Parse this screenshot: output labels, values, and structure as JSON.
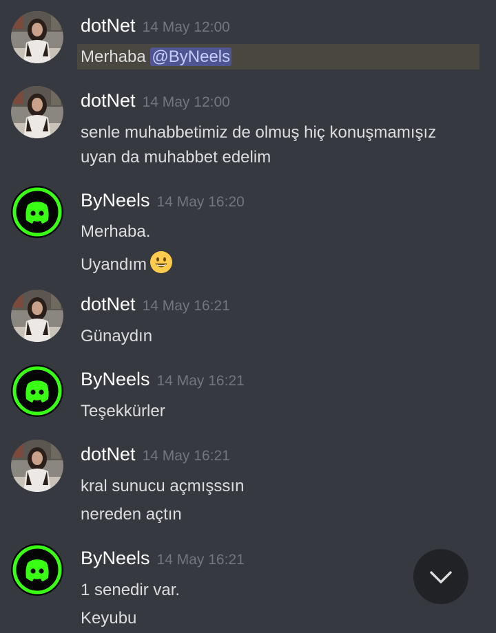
{
  "messages": [
    {
      "author": "dotNet",
      "avatar": "woman-photo-avatar",
      "timestamp": "14 May 12:00",
      "mention_prefix": "Merhaba ",
      "mention": "@ByNeels"
    },
    {
      "author": "dotNet",
      "avatar": "woman-photo-avatar",
      "timestamp": "14 May 12:00",
      "lines": [
        "senle muhabbetimiz de olmuş hiç konuşmamışız",
        "uyan da muhabbet edelim"
      ]
    },
    {
      "author": "ByNeels",
      "avatar": "discord-logo-avatar",
      "timestamp": "14 May 16:20",
      "lines": [
        "Merhaba.",
        "Uyandım"
      ],
      "emoji": "grinning-face-emoji"
    },
    {
      "author": "dotNet",
      "avatar": "woman-photo-avatar",
      "timestamp": "14 May 16:21",
      "lines": [
        "Günaydın"
      ]
    },
    {
      "author": "ByNeels",
      "avatar": "discord-logo-avatar",
      "timestamp": "14 May 16:21",
      "lines": [
        "Teşekkürler"
      ]
    },
    {
      "author": "dotNet",
      "avatar": "woman-photo-avatar",
      "timestamp": "14 May 16:21",
      "lines": [
        "kral sunucu açmışssın",
        "nereden açtın"
      ]
    },
    {
      "author": "ByNeels",
      "avatar": "discord-logo-avatar",
      "timestamp": "14 May 16:21",
      "lines": [
        "1 senedir var.",
        "Keyubu"
      ]
    }
  ],
  "scroll_button": {
    "icon": "chevron-down-icon"
  },
  "colors": {
    "background": "#36393f",
    "username": "#ffffff",
    "timestamp": "#72767d",
    "text": "#dcddde",
    "mention_highlight": "#4a4740",
    "mention_text": "#c9cdfb",
    "mention_bg": "#4e5592",
    "discord_green": "#39ff14",
    "scroll_button_bg": "#202225"
  }
}
